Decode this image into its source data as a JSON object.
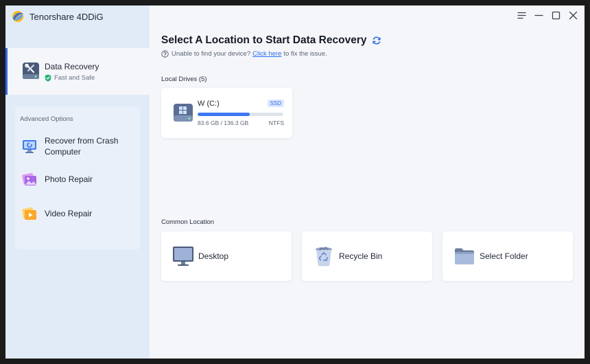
{
  "app": {
    "name": "Tenorshare 4DDiG"
  },
  "sidebar": {
    "active": {
      "title": "Data Recovery",
      "subtitle": "Fast and Safe"
    },
    "advanced": {
      "title": "Advanced Options",
      "items": [
        {
          "label": "Recover from Crash Computer",
          "icon": "crash-computer-icon"
        },
        {
          "label": "Photo Repair",
          "icon": "photo-repair-icon"
        },
        {
          "label": "Video Repair",
          "icon": "video-repair-icon"
        }
      ]
    }
  },
  "window_controls": [
    "menu-icon",
    "minimize-icon",
    "maximize-icon",
    "close-icon"
  ],
  "main": {
    "title": "Select A Location to Start Data Recovery",
    "help": {
      "prefix": "Unable to find your device?",
      "link": "Click here",
      "suffix": "to fix the issue."
    },
    "local_drives": {
      "label": "Local Drives (5)",
      "drives": [
        {
          "name": "W (C:)",
          "badge": "SSD",
          "usage": "83.6 GB / 136.3 GB",
          "used_fraction": 0.61,
          "filesystem": "NTFS"
        }
      ]
    },
    "common": {
      "label": "Common Location",
      "items": [
        {
          "label": "Desktop",
          "icon": "desktop-icon"
        },
        {
          "label": "Recycle Bin",
          "icon": "recycle-bin-icon"
        },
        {
          "label": "Select Folder",
          "icon": "folder-icon"
        }
      ]
    }
  },
  "colors": {
    "accent": "#2d6df6",
    "sidebar_bg": "#e1ebf7",
    "main_bg": "#f4f6fa",
    "success": "#22b573"
  }
}
